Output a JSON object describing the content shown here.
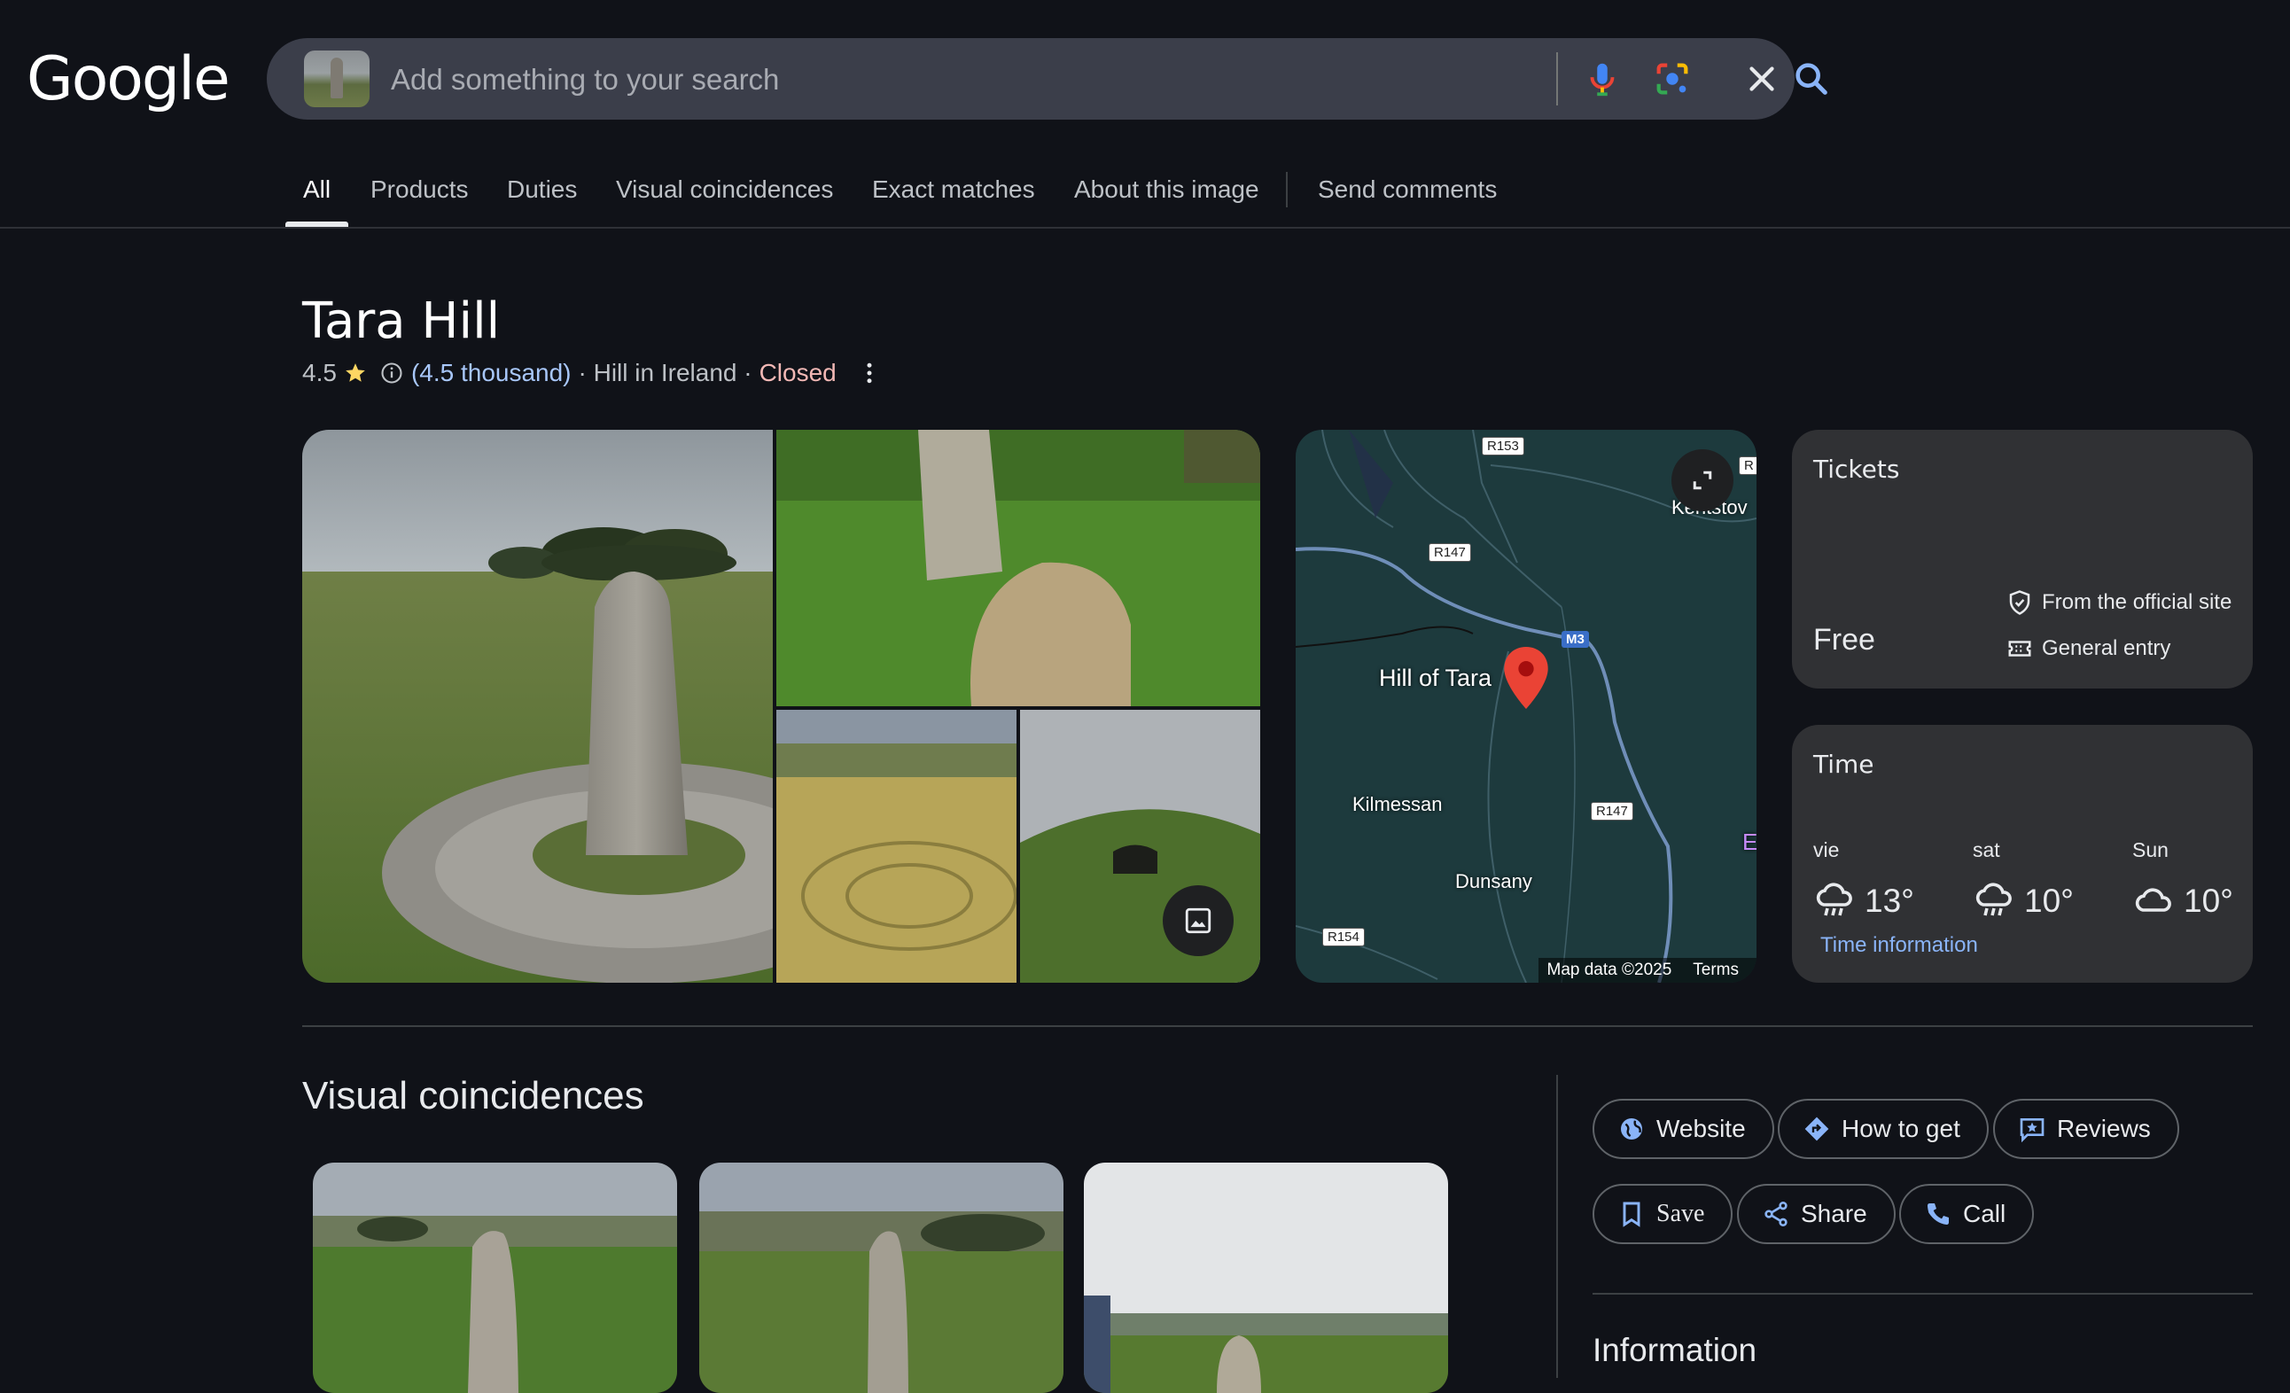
{
  "header": {
    "logo": "Google",
    "search_placeholder": "Add something to your search"
  },
  "tabs": [
    {
      "label": "All",
      "active": true
    },
    {
      "label": "Products"
    },
    {
      "label": "Duties"
    },
    {
      "label": "Visual coincidences"
    },
    {
      "label": "Exact matches"
    },
    {
      "label": "About this image"
    },
    {
      "label": "Send comments"
    }
  ],
  "place": {
    "title": "Tara Hill",
    "rating": "4.5",
    "reviews": "(4.5 thousand)",
    "category": "· Hill in Ireland ·",
    "status": "Closed"
  },
  "map": {
    "pin_label": "Hill of Tara",
    "places": [
      "Kentstov",
      "Kilmessan",
      "Dunsany",
      "E"
    ],
    "roads": [
      "R153",
      "R147",
      "R147",
      "R154",
      "R"
    ],
    "motorway": "M3",
    "footer_data": "Map data ©2025",
    "footer_terms": "Terms"
  },
  "tickets": {
    "title": "Tickets",
    "price": "Free",
    "source": "From the official site",
    "type": "General entry"
  },
  "weather": {
    "title": "Time",
    "days": [
      {
        "day": "vie",
        "temp": "13°",
        "icon": "rain-cloud-icon"
      },
      {
        "day": "sat",
        "temp": "10°",
        "icon": "rain-cloud-icon"
      },
      {
        "day": "Sun",
        "temp": "10°",
        "icon": "cloud-icon"
      }
    ],
    "link": "Time information"
  },
  "visual": {
    "title": "Visual coincidences"
  },
  "actions": {
    "website": "Website",
    "how_to_get": "How to get",
    "reviews": "Reviews",
    "save": "Save",
    "share": "Share",
    "call": "Call"
  },
  "info": {
    "title": "Information"
  },
  "colors": {
    "background": "#101218",
    "accent_blue": "#8ab4f8",
    "closed_red": "#f2b8b5",
    "star": "#fdd663",
    "pin": "#ea4335"
  }
}
